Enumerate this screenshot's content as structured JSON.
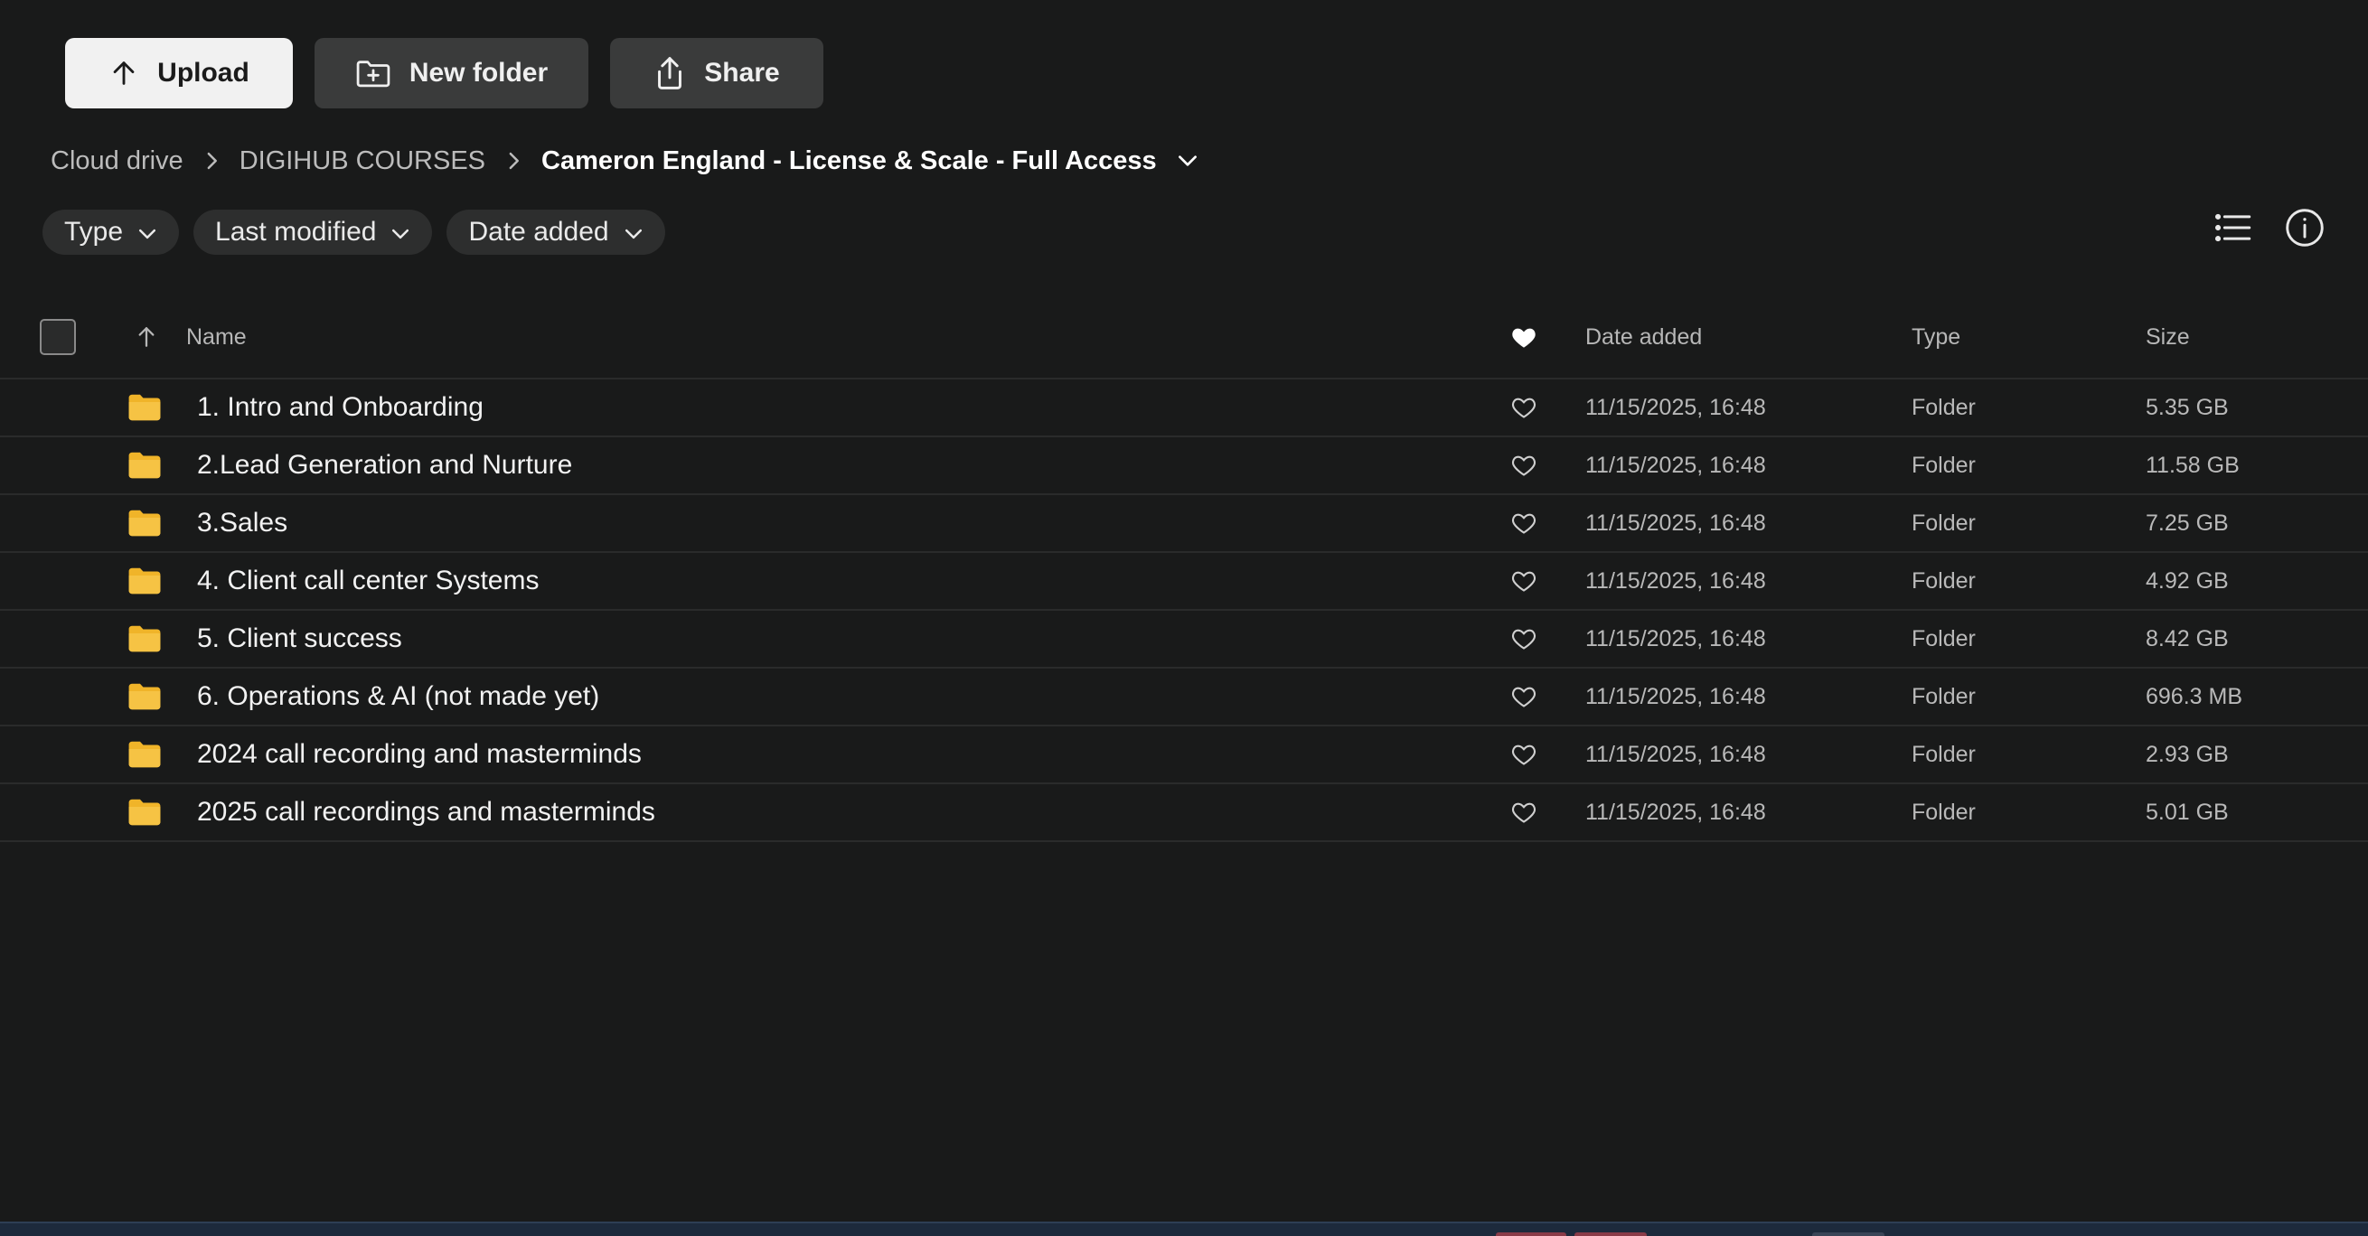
{
  "toolbar": {
    "upload_label": "Upload",
    "new_folder_label": "New folder",
    "share_label": "Share"
  },
  "breadcrumb": {
    "items": [
      "Cloud drive",
      "DIGIHUB COURSES"
    ],
    "current": "Cameron England - License & Scale - Full Access"
  },
  "filters": {
    "type": "Type",
    "last_modified": "Last modified",
    "date_added": "Date added"
  },
  "table": {
    "headers": {
      "name": "Name",
      "date_added": "Date added",
      "type": "Type",
      "size": "Size"
    },
    "rows": [
      {
        "name": "1. Intro and Onboarding",
        "date_added": "11/15/2025, 16:48",
        "type": "Folder",
        "size": "5.35 GB"
      },
      {
        "name": "2.Lead Generation and Nurture",
        "date_added": "11/15/2025, 16:48",
        "type": "Folder",
        "size": "11.58 GB"
      },
      {
        "name": "3.Sales",
        "date_added": "11/15/2025, 16:48",
        "type": "Folder",
        "size": "7.25 GB"
      },
      {
        "name": "4. Client call center Systems",
        "date_added": "11/15/2025, 16:48",
        "type": "Folder",
        "size": "4.92 GB"
      },
      {
        "name": "5. Client success",
        "date_added": "11/15/2025, 16:48",
        "type": "Folder",
        "size": "8.42 GB"
      },
      {
        "name": "6. Operations & AI (not made yet)",
        "date_added": "11/15/2025, 16:48",
        "type": "Folder",
        "size": "696.3 MB"
      },
      {
        "name": "2024 call recording and masterminds",
        "date_added": "11/15/2025, 16:48",
        "type": "Folder",
        "size": "2.93 GB"
      },
      {
        "name": "2025 call recordings and masterminds",
        "date_added": "11/15/2025, 16:48",
        "type": "Folder",
        "size": "5.01 GB"
      }
    ]
  },
  "colors": {
    "background": "#191a1a",
    "folder": "#f0b429",
    "chip": "#2d2e2e",
    "primary_button": "#f1f1f1",
    "secondary_button": "#3a3b3b"
  },
  "icons": {
    "upload": "arrow-up-icon",
    "new_folder": "folder-plus-icon",
    "share": "share-icon",
    "list_view": "list-view-icon",
    "info": "info-icon",
    "favorite": "heart-icon",
    "folder": "folder-icon"
  }
}
